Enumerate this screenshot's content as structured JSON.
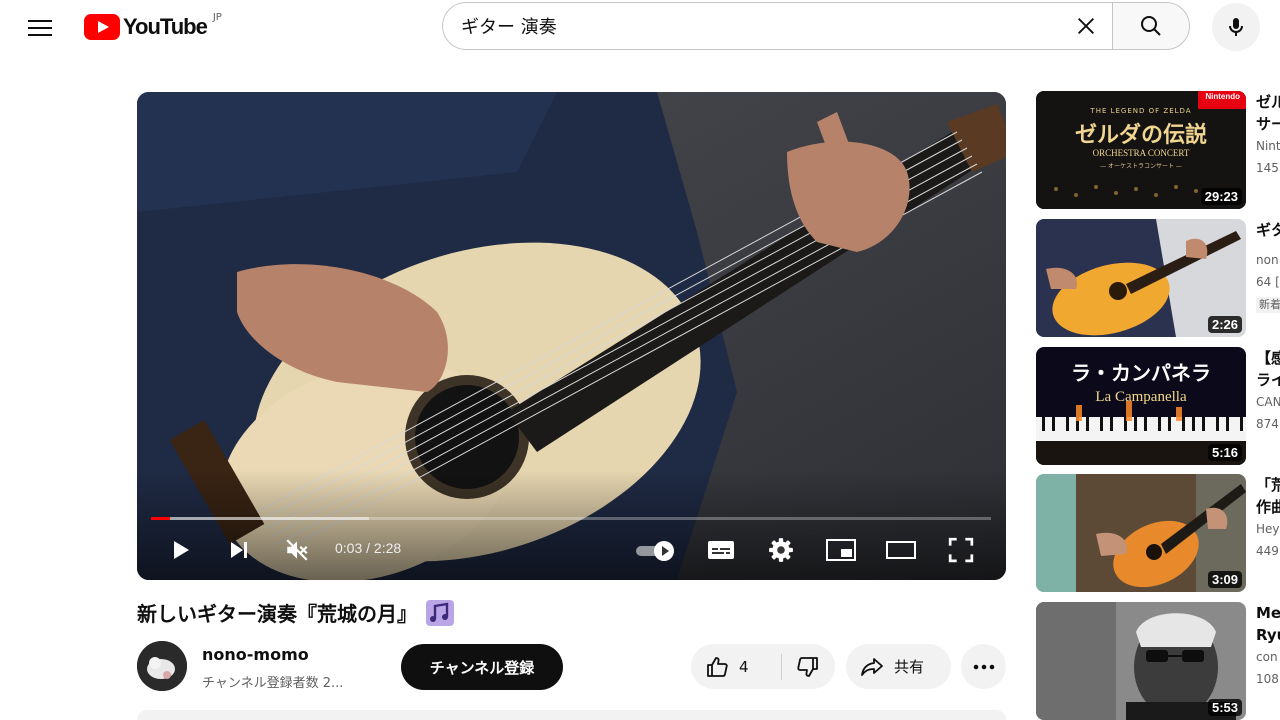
{
  "header": {
    "logo_text": "YouTube",
    "region": "JP",
    "search_query": "ギター 演奏"
  },
  "player": {
    "time_display": "0:03 / 2:28",
    "progress_fraction": 0.023,
    "buffer_fraction": 0.26,
    "muted": true
  },
  "video": {
    "title": "新しいギター演奏『荒城の月』",
    "channel_name": "nono-momo",
    "subscriber_text": "チャンネル登録者数 2...",
    "subscribe_label": "チャンネル登録",
    "like_count": "4",
    "share_label": "共有"
  },
  "recommendations": [
    {
      "thumb_title_main": "ゼルダの伝説",
      "thumb_title_top": "THE LEGEND OF ZELDA",
      "thumb_title_sub": "ORCHESTRA CONCERT",
      "thumb_title_small": "— オーケストラコンサート —",
      "thumb_brand": "Nintendo",
      "duration": "29:23",
      "title_line1": "ゼル",
      "title_line2": "サー",
      "meta1": "Nint",
      "meta2": "145"
    },
    {
      "duration": "2:26",
      "title_line1": "ギタ",
      "meta1": "non",
      "meta2": "64 [",
      "badge": "新着"
    },
    {
      "thumb_title_main": "ラ・カンパネラ",
      "thumb_title_sub": "La Campanella",
      "duration": "5:16",
      "title_line1": "【感",
      "title_line2": "ライ",
      "meta1": "CAN",
      "meta2": "874"
    },
    {
      "duration": "3:09",
      "title_line1": "「荒",
      "title_line2": "作曲",
      "meta1": "Hey",
      "meta2": "449"
    },
    {
      "duration": "5:53",
      "title_line1": "Me",
      "title_line2": "Ryu",
      "meta1": "con",
      "meta2": "108"
    }
  ],
  "colors": {
    "brand_red": "#ff0000",
    "text_primary": "#0f0f0f",
    "text_secondary": "#606060",
    "chip_bg": "#f2f2f2"
  },
  "icons": [
    "menu-icon",
    "youtube-logo-icon",
    "clear-icon",
    "search-icon",
    "mic-icon",
    "play-icon",
    "next-icon",
    "mute-icon",
    "autoplay-toggle",
    "subtitles-icon",
    "settings-icon",
    "miniplayer-icon",
    "theater-icon",
    "fullscreen-icon",
    "music-note-icon",
    "thumbs-up-icon",
    "thumbs-down-icon",
    "share-icon",
    "more-icon"
  ]
}
